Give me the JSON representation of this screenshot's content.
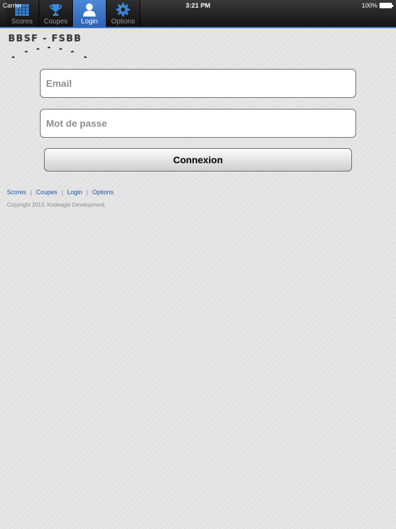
{
  "status_bar": {
    "carrier": "Carrier",
    "time": "3:21 PM",
    "battery": "100%"
  },
  "tabs": [
    {
      "label": "Scores",
      "icon": "grid-icon",
      "active": false
    },
    {
      "label": "Coupes",
      "icon": "trophy-icon",
      "active": false
    },
    {
      "label": "Login",
      "icon": "user-icon",
      "active": true
    },
    {
      "label": "Options",
      "icon": "gear-icon",
      "active": false
    }
  ],
  "logo": {
    "text": "BBSF - FSBB"
  },
  "form": {
    "email_placeholder": "Email",
    "password_placeholder": "Mot de passe",
    "submit_label": "Connexion"
  },
  "footer": {
    "links": [
      "Scores",
      "Coupes",
      "Login",
      "Options"
    ],
    "copyright": "Copyright 2013. Kodeagle Development."
  },
  "colors": {
    "accent": "#3f78c9",
    "active_tab": "#3d7bd0",
    "link": "#1b55a8",
    "background": "#e6e6e6"
  }
}
